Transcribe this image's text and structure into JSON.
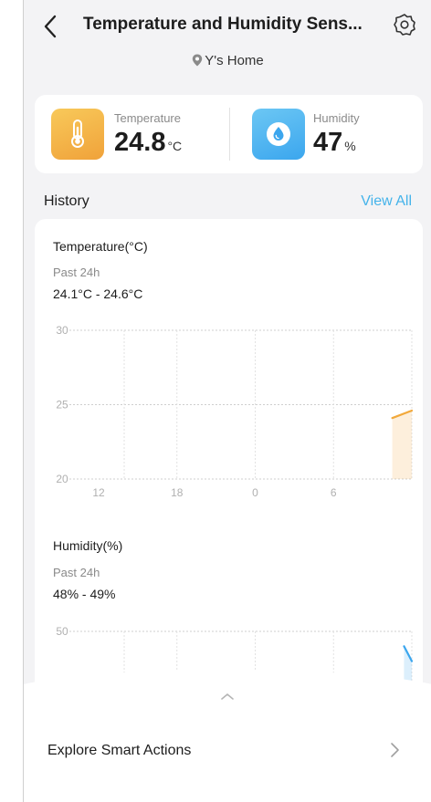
{
  "header": {
    "title": "Temperature and Humidity Sens...",
    "location": "Y's Home"
  },
  "metrics": {
    "temperature": {
      "label": "Temperature",
      "value": "24.8",
      "unit": "°C"
    },
    "humidity": {
      "label": "Humidity",
      "value": "47",
      "unit": "%"
    }
  },
  "history": {
    "title": "History",
    "view_all": "View All"
  },
  "charts": {
    "temperature": {
      "title": "Temperature(°C)",
      "period": "Past 24h",
      "range": "24.1°C - 24.6°C"
    },
    "humidity": {
      "title": "Humidity(%)",
      "period": "Past 24h",
      "range": "48% - 49%"
    }
  },
  "chart_data": [
    {
      "type": "line",
      "title": "Temperature(°C)",
      "x_ticks": [
        "12",
        "18",
        "0",
        "6"
      ],
      "y_ticks": [
        "30",
        "25",
        "20"
      ],
      "ylim": [
        20,
        30
      ],
      "series": [
        {
          "x": [
            7.5,
            8
          ],
          "y": [
            24.1,
            24.6
          ]
        }
      ],
      "grid": true,
      "color": "#f2a93b"
    },
    {
      "type": "line",
      "title": "Humidity(%)",
      "y_ticks": [
        "50"
      ],
      "ylim": [
        40,
        50
      ],
      "series": [
        {
          "x": [
            7.8,
            8
          ],
          "y": [
            49,
            48
          ]
        }
      ],
      "grid": true,
      "color": "#3ba6ee"
    }
  ],
  "footer": {
    "smart_actions": "Explore Smart Actions"
  }
}
